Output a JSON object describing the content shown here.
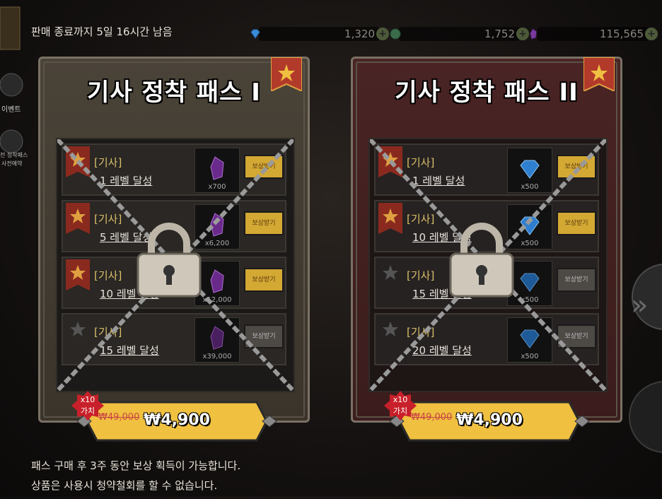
{
  "header": {
    "sale_end": "판매 종료까지 5일 16시간 남음",
    "currencies": [
      {
        "icon": "blue-gem-icon",
        "value": "1,320"
      },
      {
        "icon": "green-coin-icon",
        "value": "1,752"
      },
      {
        "icon": "purple-crystal-icon",
        "value": "115,565"
      }
    ]
  },
  "sidebar": {
    "event_label": "이벤트",
    "menu_label_1": "전 정착패스",
    "menu_label_2": "사전예약"
  },
  "passes": [
    {
      "title": "기사 정착 패스 I",
      "rows": [
        {
          "tag": "[기사]",
          "level": "1 레벨 달성",
          "qty": "x700",
          "claim": "보상받기",
          "item_icon": "purple-crystal-icon"
        },
        {
          "tag": "[기사]",
          "level": "5 레벨 달성",
          "qty": "x6,200",
          "claim": "보상받기",
          "item_icon": "purple-crystal-icon"
        },
        {
          "tag": "[기사]",
          "level": "10 레벨 달성",
          "qty": "x12,000",
          "claim": "보상받기",
          "item_icon": "purple-crystal-icon"
        },
        {
          "tag": "[기사]",
          "level": "15 레벨 달성",
          "qty": "x39,000",
          "claim": "보상받기",
          "item_icon": "purple-crystal-icon"
        }
      ],
      "badge": "x10\n가치",
      "badge_x10": "x10",
      "badge_value": "가치",
      "old_price": "₩49,000",
      "price": "₩4,900"
    },
    {
      "title": "기사 정착 패스 II",
      "rows": [
        {
          "tag": "[기사]",
          "level": "1 레벨 달성",
          "qty": "x500",
          "claim": "보상받기",
          "item_icon": "blue-gem-icon"
        },
        {
          "tag": "[기사]",
          "level": "10 레벨 달성",
          "qty": "x500",
          "claim": "보상받기",
          "item_icon": "blue-gem-icon"
        },
        {
          "tag": "[기사]",
          "level": "15 레벨 달성",
          "qty": "x500",
          "claim": "보상받기",
          "item_icon": "blue-gem-icon"
        },
        {
          "tag": "[기사]",
          "level": "20 레벨 달성",
          "qty": "x500",
          "claim": "보상받기",
          "item_icon": "blue-gem-icon"
        }
      ],
      "badge_x10": "x10",
      "badge_value": "가치",
      "old_price": "₩49,000",
      "price": "₩4,900"
    }
  ],
  "footer": {
    "line1": "패스 구매 후 3주 동안 보상 획득이 가능합니다.",
    "line2": "상품은 사용시 청약철회를 할 수 없습니다."
  },
  "colors": {
    "accent_gold": "#f0c040",
    "sale_red": "#c94444",
    "claim_gold": "#d3a833"
  }
}
